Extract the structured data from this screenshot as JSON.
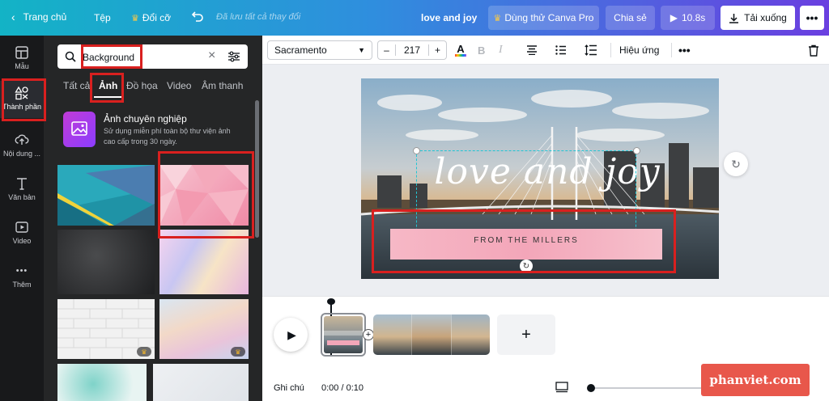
{
  "topbar": {
    "home_label": "Trang chủ",
    "file_label": "Tệp",
    "resize_label": "Đổi cỡ",
    "save_status": "Đã lưu tất cả thay đổi",
    "design_title": "love and joy",
    "try_pro_label": "Dùng thử Canva Pro",
    "share_label": "Chia sẻ",
    "play_duration": "10.8s",
    "download_label": "Tải xuống"
  },
  "rail": {
    "items": [
      {
        "label": "Mẫu",
        "icon": "template-icon"
      },
      {
        "label": "Thành phần",
        "icon": "elements-icon"
      },
      {
        "label": "Nội dung ...",
        "icon": "upload-icon"
      },
      {
        "label": "Văn bản",
        "icon": "text-icon"
      },
      {
        "label": "Video",
        "icon": "video-icon"
      },
      {
        "label": "Thêm",
        "icon": "more-icon"
      }
    ]
  },
  "panel": {
    "search_value": "Background",
    "tabs": [
      "Tất cả",
      "Ảnh",
      "Đồ họa",
      "Video",
      "Âm thanh"
    ],
    "active_tab": "Ảnh",
    "promo_title": "Ảnh chuyên nghiệp",
    "promo_desc_line1": "Sử dụng miễn phí toàn bộ thư viện ảnh",
    "promo_desc_line2": "cao cấp trong 30 ngày."
  },
  "toolbar": {
    "font_name": "Sacramento",
    "font_size": "217",
    "effects_label": "Hiệu ứng"
  },
  "canvas": {
    "headline": "love and joy",
    "subline": "FROM THE MILLERS"
  },
  "timeline": {
    "notes_label": "Ghi chú",
    "time_readout": "0:00 / 0:10"
  },
  "watermark": "phanviet.com",
  "colors": {
    "accent_red": "#d9201f",
    "pro_purple": "#8b3dff",
    "watermark_bg": "#e8574b"
  }
}
